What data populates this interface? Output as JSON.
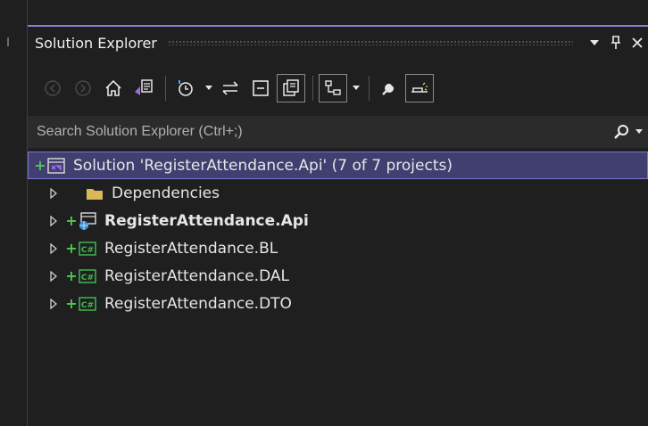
{
  "panel": {
    "title": "Solution Explorer",
    "accent_color": "#8f7bd8"
  },
  "title_buttons": {
    "dropdown": "▾",
    "pin": "⟂",
    "close": "✕"
  },
  "search": {
    "placeholder": "Search Solution Explorer (Ctrl+;)",
    "value": ""
  },
  "tree": {
    "solution": {
      "label": "Solution 'RegisterAttendance.Api' (7 of 7 projects)",
      "icon": "solution-icon",
      "pending_add": "+"
    },
    "items": [
      {
        "label": "Dependencies",
        "icon": "folder-icon",
        "bold": false,
        "pending_add": ""
      },
      {
        "label": "RegisterAttendance.Api",
        "icon": "web-project-icon",
        "bold": true,
        "pending_add": "+"
      },
      {
        "label": "RegisterAttendance.BL",
        "icon": "csharp-project-icon",
        "bold": false,
        "pending_add": "+"
      },
      {
        "label": "RegisterAttendance.DAL",
        "icon": "csharp-project-icon",
        "bold": false,
        "pending_add": "+"
      },
      {
        "label": "RegisterAttendance.DTO",
        "icon": "csharp-project-icon",
        "bold": false,
        "pending_add": "+"
      }
    ]
  },
  "colors": {
    "background": "#1f1f1f",
    "selection": "#403f70",
    "add_marker": "#4ec94e"
  }
}
